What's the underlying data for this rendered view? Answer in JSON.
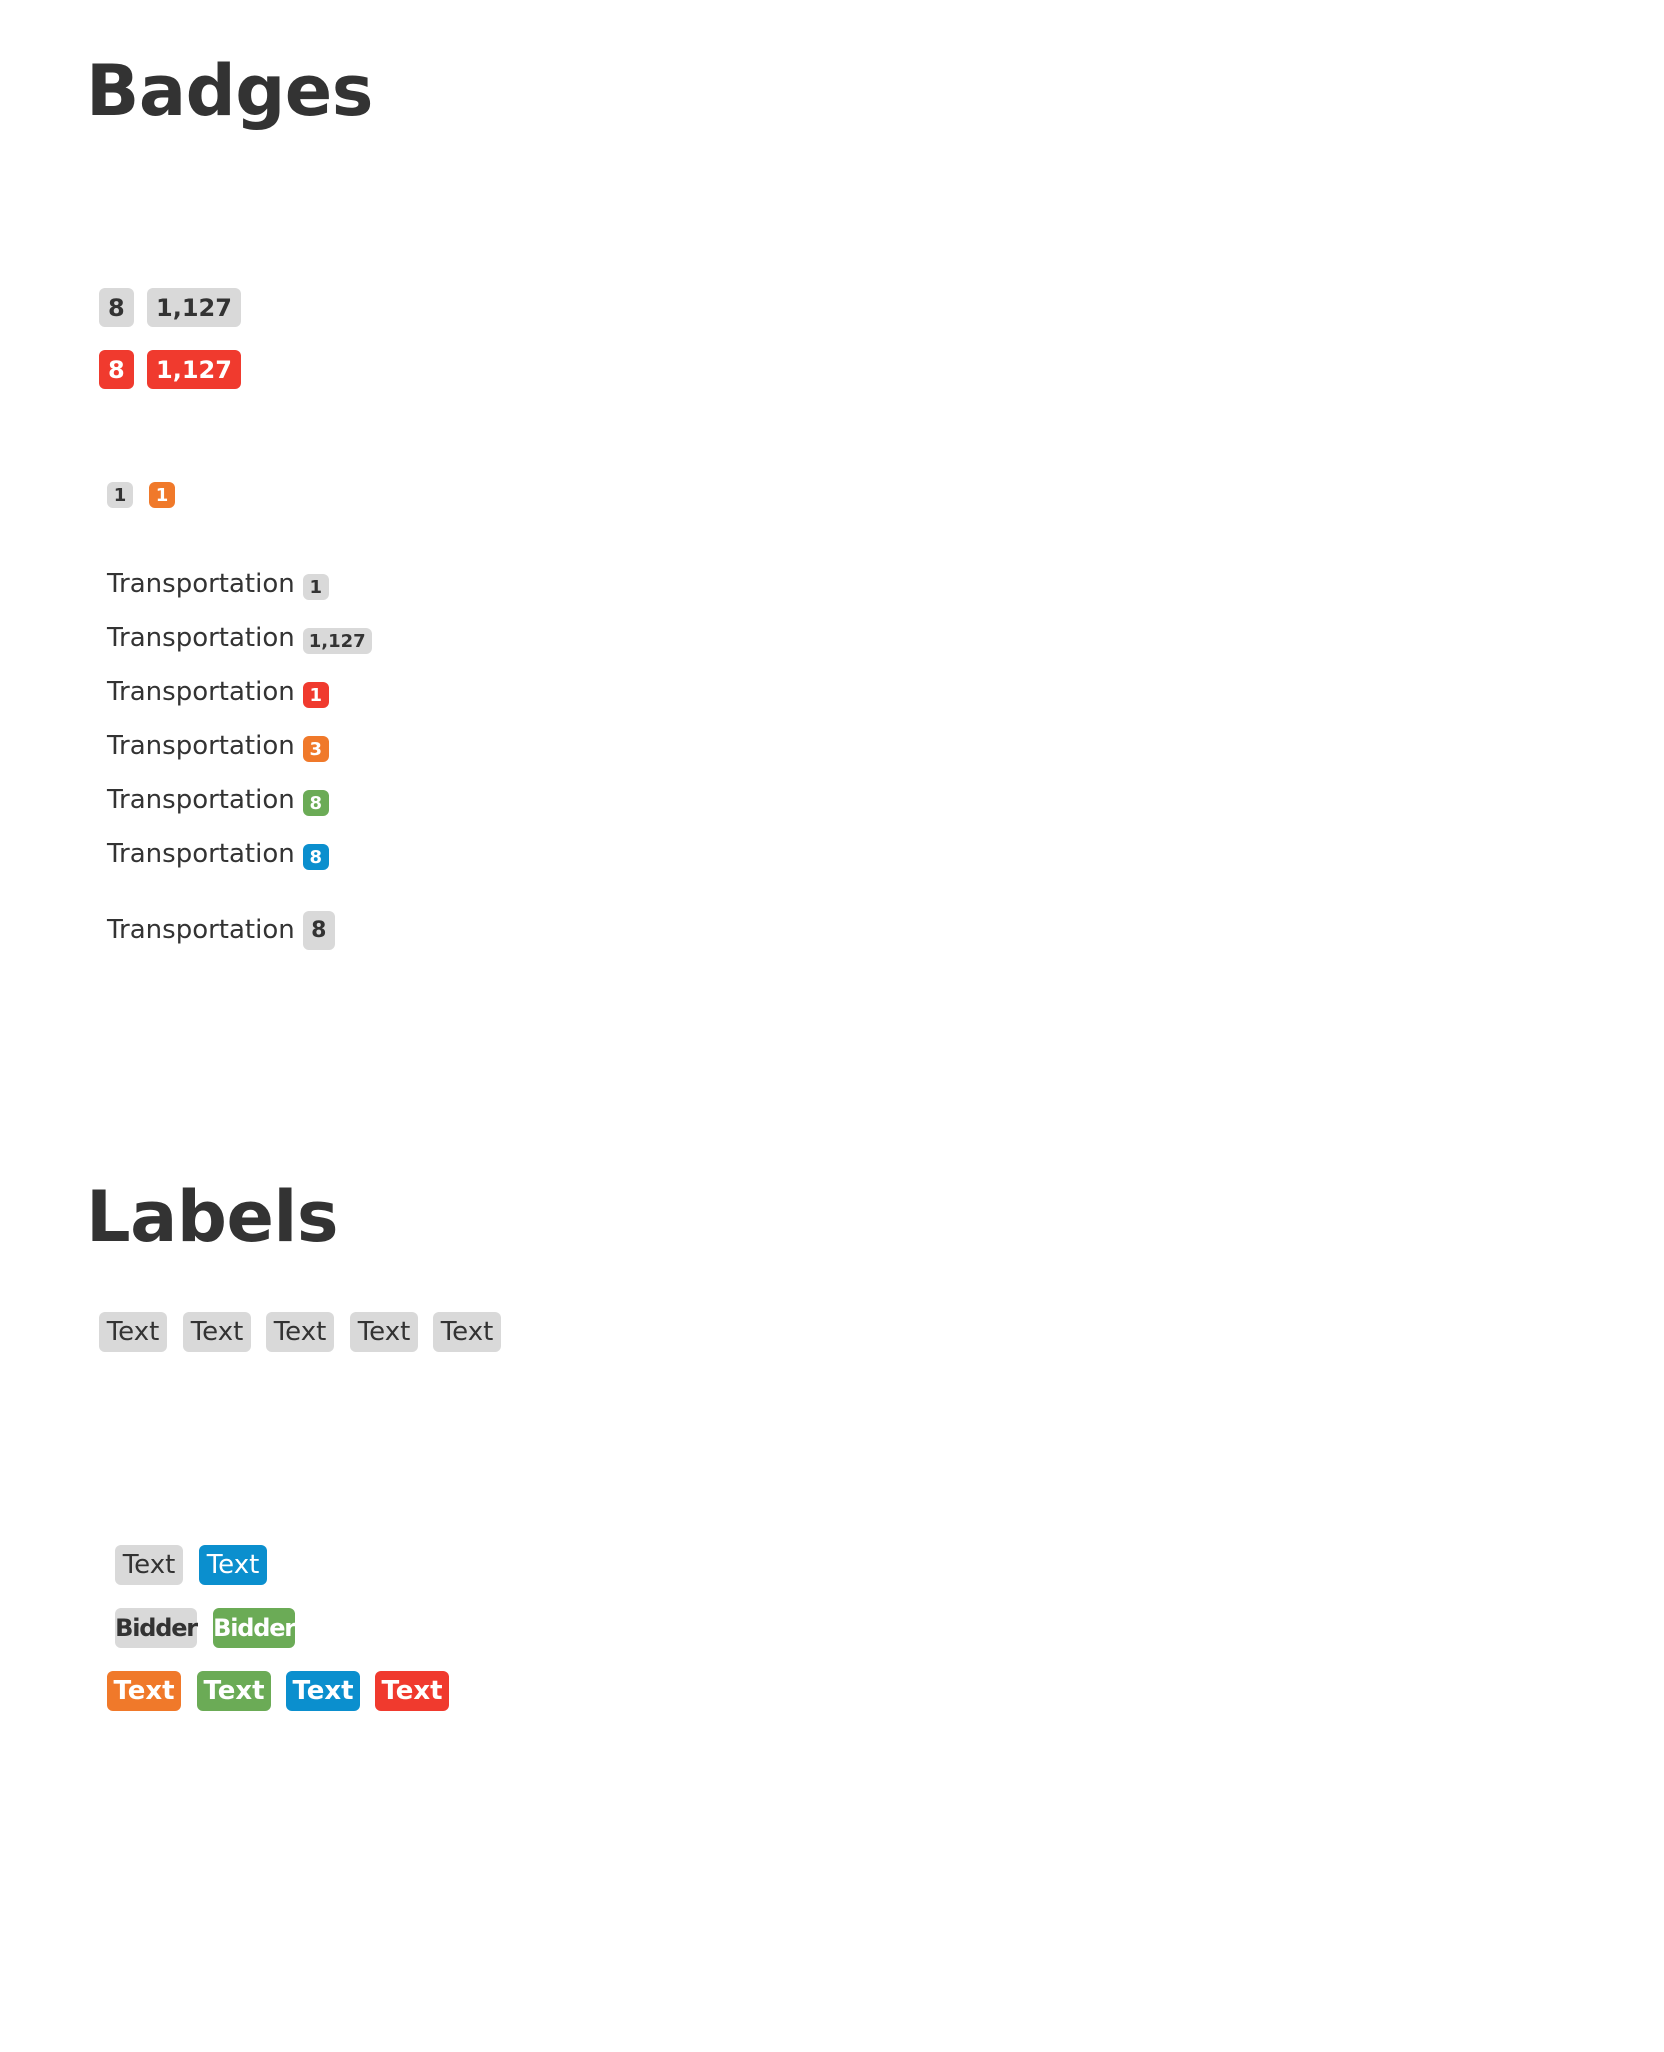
{
  "badges_section": {
    "title": "Badges",
    "row_gray": [
      "8",
      "1,127"
    ],
    "row_red": [
      "8",
      "1,127"
    ],
    "row_small": [
      "1",
      "1"
    ],
    "list": [
      {
        "text": "Transportation",
        "badge": "1",
        "color": "gray"
      },
      {
        "text": "Transportation",
        "badge": "1,127",
        "color": "gray"
      },
      {
        "text": "Transportation",
        "badge": "1",
        "color": "red"
      },
      {
        "text": "Transportation",
        "badge": "3",
        "color": "orange"
      },
      {
        "text": "Transportation",
        "badge": "8",
        "color": "green"
      },
      {
        "text": "Transportation",
        "badge": "8",
        "color": "blue"
      },
      {
        "text": "Transportation",
        "badge": "8",
        "color": "gray"
      }
    ]
  },
  "labels_section": {
    "title": "Labels",
    "row_gray": [
      "Text",
      "Text",
      "Text",
      "Text",
      "Text"
    ],
    "row_pair": [
      "Text",
      "Text"
    ],
    "row_bidder": [
      "Bidder",
      "Bidder"
    ],
    "row_colored": [
      "Text",
      "Text",
      "Text",
      "Text"
    ]
  },
  "colors": {
    "gray": "#d9d9d9",
    "red": "#f03a2e",
    "orange": "#f0792a",
    "green": "#6bab56",
    "blue": "#0b8fce",
    "text": "#333333"
  }
}
